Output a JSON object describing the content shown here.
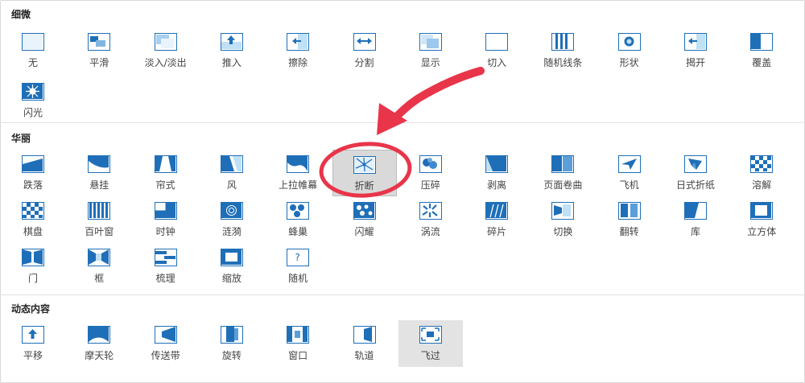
{
  "colors": {
    "accent": "#1f6fb8",
    "light": "#bfe0f5",
    "annotation": "#e8354a",
    "selected_bg": "#d9d9d9"
  },
  "sections": [
    {
      "title": "细微",
      "items": [
        {
          "label": "无",
          "icon": "none-icon"
        },
        {
          "label": "平滑",
          "icon": "morph-icon"
        },
        {
          "label": "淡入/淡出",
          "icon": "fade-icon"
        },
        {
          "label": "推入",
          "icon": "push-icon"
        },
        {
          "label": "擦除",
          "icon": "wipe-icon"
        },
        {
          "label": "分割",
          "icon": "split-icon"
        },
        {
          "label": "显示",
          "icon": "reveal-icon"
        },
        {
          "label": "切入",
          "icon": "cut-icon"
        },
        {
          "label": "随机线条",
          "icon": "random-bars-icon"
        },
        {
          "label": "形状",
          "icon": "shape-icon"
        },
        {
          "label": "揭开",
          "icon": "uncover-icon"
        },
        {
          "label": "覆盖",
          "icon": "cover-icon"
        },
        {
          "label": "闪光",
          "icon": "flash-icon"
        }
      ]
    },
    {
      "title": "华丽",
      "items": [
        {
          "label": "跌落",
          "icon": "fall-over-icon"
        },
        {
          "label": "悬挂",
          "icon": "drape-icon"
        },
        {
          "label": "帘式",
          "icon": "curtains-icon"
        },
        {
          "label": "风",
          "icon": "wind-icon"
        },
        {
          "label": "上拉帷幕",
          "icon": "prestige-icon"
        },
        {
          "label": "折断",
          "icon": "fracture-icon",
          "selected": true
        },
        {
          "label": "压碎",
          "icon": "crush-icon"
        },
        {
          "label": "剥离",
          "icon": "peel-off-icon"
        },
        {
          "label": "页面卷曲",
          "icon": "page-curl-icon"
        },
        {
          "label": "飞机",
          "icon": "airplane-icon"
        },
        {
          "label": "日式折纸",
          "icon": "origami-icon"
        },
        {
          "label": "溶解",
          "icon": "dissolve-icon"
        },
        {
          "label": "棋盘",
          "icon": "checkerboard-icon"
        },
        {
          "label": "百叶窗",
          "icon": "blinds-icon"
        },
        {
          "label": "时钟",
          "icon": "clock-icon"
        },
        {
          "label": "涟漪",
          "icon": "ripple-icon"
        },
        {
          "label": "蜂巢",
          "icon": "honeycomb-icon"
        },
        {
          "label": "闪耀",
          "icon": "glitter-icon"
        },
        {
          "label": "涡流",
          "icon": "vortex-icon"
        },
        {
          "label": "碎片",
          "icon": "shred-icon"
        },
        {
          "label": "切换",
          "icon": "switch-icon"
        },
        {
          "label": "翻转",
          "icon": "flip-icon"
        },
        {
          "label": "库",
          "icon": "gallery-icon"
        },
        {
          "label": "立方体",
          "icon": "cube-icon"
        },
        {
          "label": "门",
          "icon": "doors-icon"
        },
        {
          "label": "框",
          "icon": "box-icon"
        },
        {
          "label": "梳理",
          "icon": "comb-icon"
        },
        {
          "label": "缩放",
          "icon": "zoom-icon"
        },
        {
          "label": "随机",
          "icon": "random-icon"
        }
      ]
    },
    {
      "title": "动态内容",
      "items": [
        {
          "label": "平移",
          "icon": "pan-icon"
        },
        {
          "label": "摩天轮",
          "icon": "ferris-wheel-icon"
        },
        {
          "label": "传送带",
          "icon": "conveyor-icon"
        },
        {
          "label": "旋转",
          "icon": "rotate-icon"
        },
        {
          "label": "窗口",
          "icon": "window-icon"
        },
        {
          "label": "轨道",
          "icon": "orbit-icon"
        },
        {
          "label": "飞过",
          "icon": "fly-through-icon",
          "hovered": true
        }
      ]
    }
  ]
}
